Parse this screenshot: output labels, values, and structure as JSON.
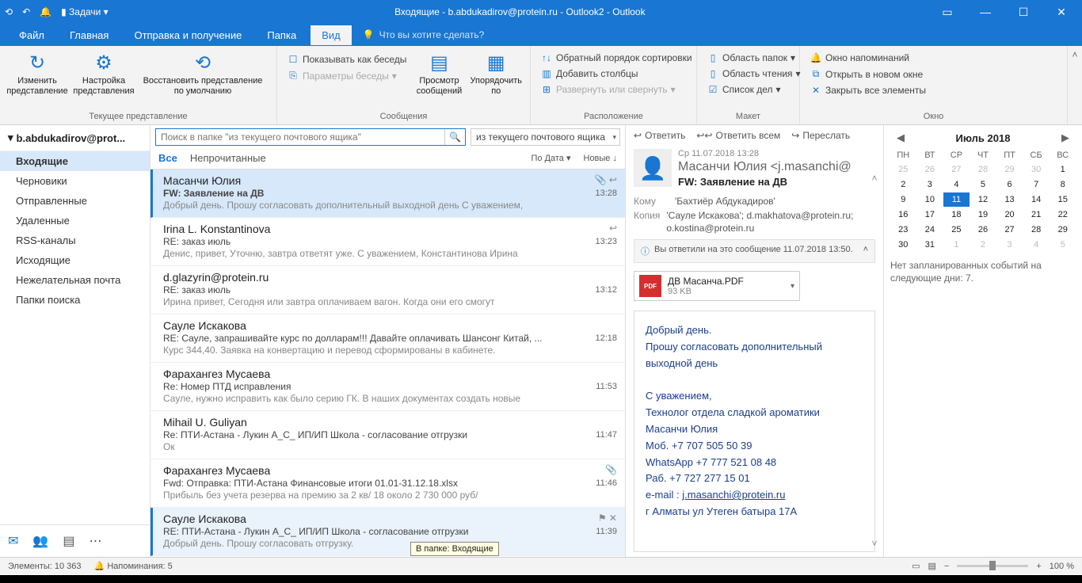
{
  "title": "Входящие - b.abdukadirov@protein.ru - Outlook2  -  Outlook",
  "qat": {
    "tasks": "Задачи"
  },
  "menu": {
    "file": "Файл",
    "home": "Главная",
    "sendrecv": "Отправка и получение",
    "folder": "Папка",
    "view": "Вид",
    "tell": "Что вы хотите сделать?"
  },
  "ribbon": {
    "g1": {
      "change": "Изменить представление",
      "settings": "Настройка представления",
      "reset": "Восстановить представление по умолчанию",
      "label": "Текущее представление"
    },
    "g2": {
      "conv": "Показывать как беседы",
      "params": "Параметры беседы",
      "preview": "Просмотр сообщений",
      "arrange": "Упорядочить по",
      "label": "Сообщения"
    },
    "g3": {
      "reverse": "Обратный порядок сортировки",
      "addcol": "Добавить столбцы",
      "expand": "Развернуть или свернуть",
      "label": "Расположение"
    },
    "g4": {
      "folders": "Область папок",
      "reading": "Область чтения",
      "todo": "Список дел",
      "label": "Макет"
    },
    "g5": {
      "reminders": "Окно напоминаний",
      "newwin": "Открыть в новом окне",
      "closeall": "Закрыть все элементы",
      "label": "Окно"
    }
  },
  "nav": {
    "account": "b.abdukadirov@prot...",
    "items": [
      "Входящие",
      "Черновики",
      "Отправленные",
      "Удаленные",
      "RSS-каналы",
      "Исходящие",
      "Нежелательная почта",
      "Папки поиска"
    ]
  },
  "search": {
    "placeholder": "Поиск в папке \"из текущего почтового ящика\"",
    "scope": "из текущего почтового ящика"
  },
  "filter": {
    "all": "Все",
    "unread": "Непрочитанные",
    "sortby": "По Дата ▾",
    "newest": "Новые ↓"
  },
  "mails": [
    {
      "from": "Масанчи Юлия",
      "subj": "FW: Заявление на ДВ",
      "prev": "Добрый день.   Прошу согласовать дополнительный выходной день  С уважением,",
      "time": "13:28",
      "icons": "📎 ↩"
    },
    {
      "from": "Irina L. Konstantinova",
      "subj": "RE: заказ июль",
      "prev": "Денис, привет,  Уточню, завтра ответят уже.  С уважением,  Константинова Ирина",
      "time": "13:23",
      "icons": "↩"
    },
    {
      "from": "d.glazyrin@protein.ru",
      "subj": "RE: заказ июль",
      "prev": "Ирина привет, Сегодня или завтра оплачиваем вагон. Когда  они его смогут",
      "time": "13:12",
      "icons": ""
    },
    {
      "from": "Сауле Искакова",
      "subj": "RE: Сауле, запрашивайте курс по долларам!!! Давайте оплачивать Шансонг Китай, ...",
      "prev": "Курс 344,40. Заявка на конвертацию и перевод сформированы в кабинете.",
      "time": "12:18",
      "icons": ""
    },
    {
      "from": "Фарахангез Мусаева",
      "subj": "Re: Номер ПТД исправления",
      "prev": "Сауле, нужно исправить как было серию ГК.  В наших документах создать новые",
      "time": "11:53",
      "icons": ""
    },
    {
      "from": "Mihail U. Guliyan",
      "subj": "Re: ПТИ-Астана - Лукин А_С_ ИП/ИП Школа - согласование отгрузки",
      "prev": "Ок",
      "time": "11:47",
      "icons": ""
    },
    {
      "from": "Фарахангез Мусаева",
      "subj": "Fwd: Отправка: ПТИ-Астана Финансовые итоги 01.01-31.12.18.xlsx",
      "prev": "Прибыль без учета резерва на премию за 2 кв/ 18 около 2 730 000 руб/",
      "time": "11:46",
      "icons": "📎"
    },
    {
      "from": "Сауле Искакова",
      "subj": "RE: ПТИ-Астана - Лукин А_С_ ИП/ИП Школа - согласование отгрузки",
      "prev": "Добрый день.  Прошу согласовать отгрузку.",
      "time": "11:39",
      "icons": "⚑ ✕"
    }
  ],
  "read": {
    "reply": "Ответить",
    "replyall": "Ответить всем",
    "forward": "Переслать",
    "date": "Ср 11.07.2018 13:28",
    "sender": "Масанчи Юлия <j.masanchi@",
    "subject": "FW: Заявление на ДВ",
    "to_lbl": "Кому",
    "to": "'Бахтиёр Абдукадиров'",
    "cc_lbl": "Копия",
    "cc": "'Сауле Искакова'; d.makhatova@protein.ru; o.kostina@protein.ru",
    "info": "Вы ответили на это сообщение 11.07.2018 13:50.",
    "att_name": "ДВ Масанча.PDF",
    "att_size": "93 KB",
    "body_greet": "Добрый день.",
    "body_req": "Прошу согласовать дополнительный выходной день",
    "sig1": "С уважением,",
    "sig2": "Технолог отдела сладкой ароматики",
    "sig3": "Масанчи Юлия",
    "sig4": "Моб. +7 707 505 50 39",
    "sig5": "WhatsApp +7 777 521 08 48",
    "sig6": "Раб. +7 727 277 15 01",
    "sig7": "e-mail : ",
    "sig7_link": "j.masanchi@protein.ru",
    "sig8": "г Алматы  ул Утеген батыра 17А"
  },
  "cal": {
    "title": "Июль 2018",
    "dow": [
      "ПН",
      "ВТ",
      "СР",
      "ЧТ",
      "ПТ",
      "СБ",
      "ВС"
    ],
    "days": [
      {
        "n": "25",
        "dim": true
      },
      {
        "n": "26",
        "dim": true
      },
      {
        "n": "27",
        "dim": true
      },
      {
        "n": "28",
        "dim": true
      },
      {
        "n": "29",
        "dim": true
      },
      {
        "n": "30",
        "dim": true
      },
      {
        "n": "1"
      },
      {
        "n": "2"
      },
      {
        "n": "3"
      },
      {
        "n": "4"
      },
      {
        "n": "5"
      },
      {
        "n": "6"
      },
      {
        "n": "7"
      },
      {
        "n": "8"
      },
      {
        "n": "9"
      },
      {
        "n": "10"
      },
      {
        "n": "11",
        "today": true
      },
      {
        "n": "12"
      },
      {
        "n": "13"
      },
      {
        "n": "14"
      },
      {
        "n": "15"
      },
      {
        "n": "16"
      },
      {
        "n": "17"
      },
      {
        "n": "18"
      },
      {
        "n": "19"
      },
      {
        "n": "20"
      },
      {
        "n": "21"
      },
      {
        "n": "22"
      },
      {
        "n": "23"
      },
      {
        "n": "24"
      },
      {
        "n": "25"
      },
      {
        "n": "26"
      },
      {
        "n": "27"
      },
      {
        "n": "28"
      },
      {
        "n": "29"
      },
      {
        "n": "30"
      },
      {
        "n": "31"
      },
      {
        "n": "1",
        "dim": true
      },
      {
        "n": "2",
        "dim": true
      },
      {
        "n": "3",
        "dim": true
      },
      {
        "n": "4",
        "dim": true
      },
      {
        "n": "5",
        "dim": true
      }
    ],
    "note": "Нет запланированных событий на следующие дни: 7."
  },
  "status": {
    "items": "Элементы: 10 363",
    "reminders": "Напоминания: 5",
    "zoom": "100 %"
  },
  "tooltip": "В папке: Входящие"
}
